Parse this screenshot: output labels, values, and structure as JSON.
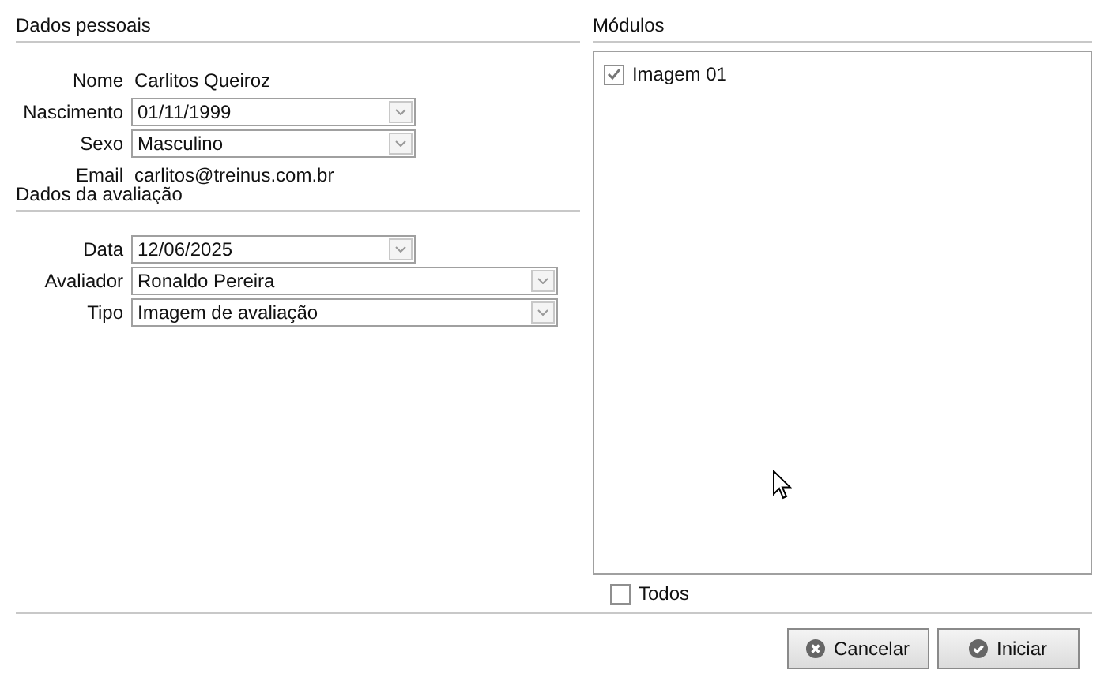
{
  "personal": {
    "title": "Dados pessoais",
    "fields": [
      {
        "label": "Nome",
        "kind": "text",
        "value": "Carlitos Queiroz"
      },
      {
        "label": "Nascimento",
        "kind": "dropdown",
        "value": "01/11/1999"
      },
      {
        "label": "Sexo",
        "kind": "dropdown",
        "value": "Masculino"
      },
      {
        "label": "Email",
        "kind": "text",
        "value": "carlitos@treinus.com.br"
      }
    ]
  },
  "evaluation": {
    "title": "Dados da avaliação",
    "fields": [
      {
        "label": "Data",
        "kind": "dropdown",
        "value": "12/06/2025"
      },
      {
        "label": "Avaliador",
        "kind": "dropdown",
        "value": "Ronaldo Pereira"
      },
      {
        "label": "Tipo",
        "kind": "dropdown",
        "value": "Imagem de avaliação"
      }
    ]
  },
  "modules": {
    "title": "Módulos",
    "items": [
      {
        "label": "Imagem 01",
        "checked": true
      }
    ],
    "all": {
      "label": "Todos",
      "checked": false
    }
  },
  "buttons": [
    {
      "label": "Cancelar",
      "kind": "cancel"
    },
    {
      "label": "Iniciar",
      "kind": "confirm"
    }
  ]
}
